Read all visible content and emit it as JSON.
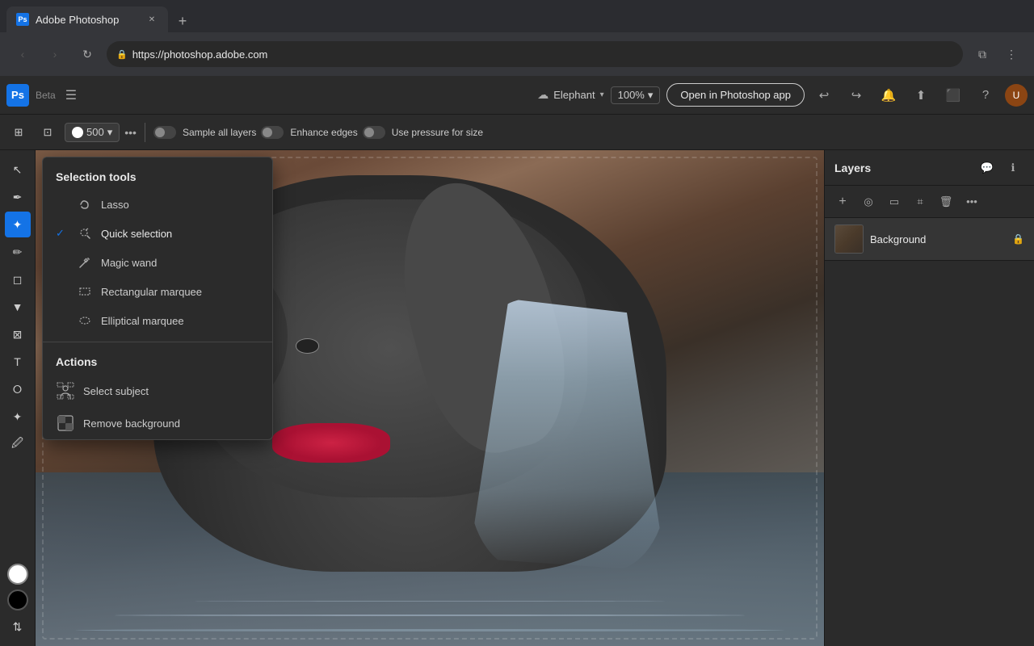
{
  "browser": {
    "tab_title": "Adobe Photoshop",
    "tab_favicon": "Ps",
    "url": "https://photoshop.adobe.com",
    "new_tab_icon": "+",
    "nav_back": "‹",
    "nav_forward": "›",
    "nav_reload": "↻"
  },
  "app": {
    "logo": "Ps",
    "beta_label": "Beta",
    "menu_icon": "☰",
    "cloud_name": "Elephant",
    "zoom_level": "100%",
    "open_in_ps_btn": "Open in Photoshop app",
    "undo_icon": "↩",
    "redo_icon": "↪"
  },
  "toolbar": {
    "size_value": "500",
    "sample_layers_label": "Sample all layers",
    "enhance_edges_label": "Enhance edges",
    "use_pressure_label": "Use pressure for size"
  },
  "selection_dropdown": {
    "section_title": "Selection tools",
    "items": [
      {
        "id": "lasso",
        "label": "Lasso",
        "checked": false,
        "icon": "⌒"
      },
      {
        "id": "quick-selection",
        "label": "Quick selection",
        "checked": true,
        "icon": "✦"
      },
      {
        "id": "magic-wand",
        "label": "Magic wand",
        "checked": false,
        "icon": "✳"
      },
      {
        "id": "rectangular-marquee",
        "label": "Rectangular marquee",
        "checked": false,
        "icon": "▭"
      },
      {
        "id": "elliptical-marquee",
        "label": "Elliptical marquee",
        "checked": false,
        "icon": "◯"
      }
    ],
    "actions_title": "Actions",
    "actions": [
      {
        "id": "select-subject",
        "label": "Select subject",
        "icon": "👤"
      },
      {
        "id": "remove-background",
        "label": "Remove background",
        "icon": "🖼"
      }
    ]
  },
  "layers_panel": {
    "title": "Layers",
    "layer_name": "Background",
    "add_icon": "+",
    "circle_icon": "◎",
    "rect_icon": "▭",
    "clip_icon": "⌗",
    "delete_icon": "🗑",
    "more_icon": "•••"
  }
}
